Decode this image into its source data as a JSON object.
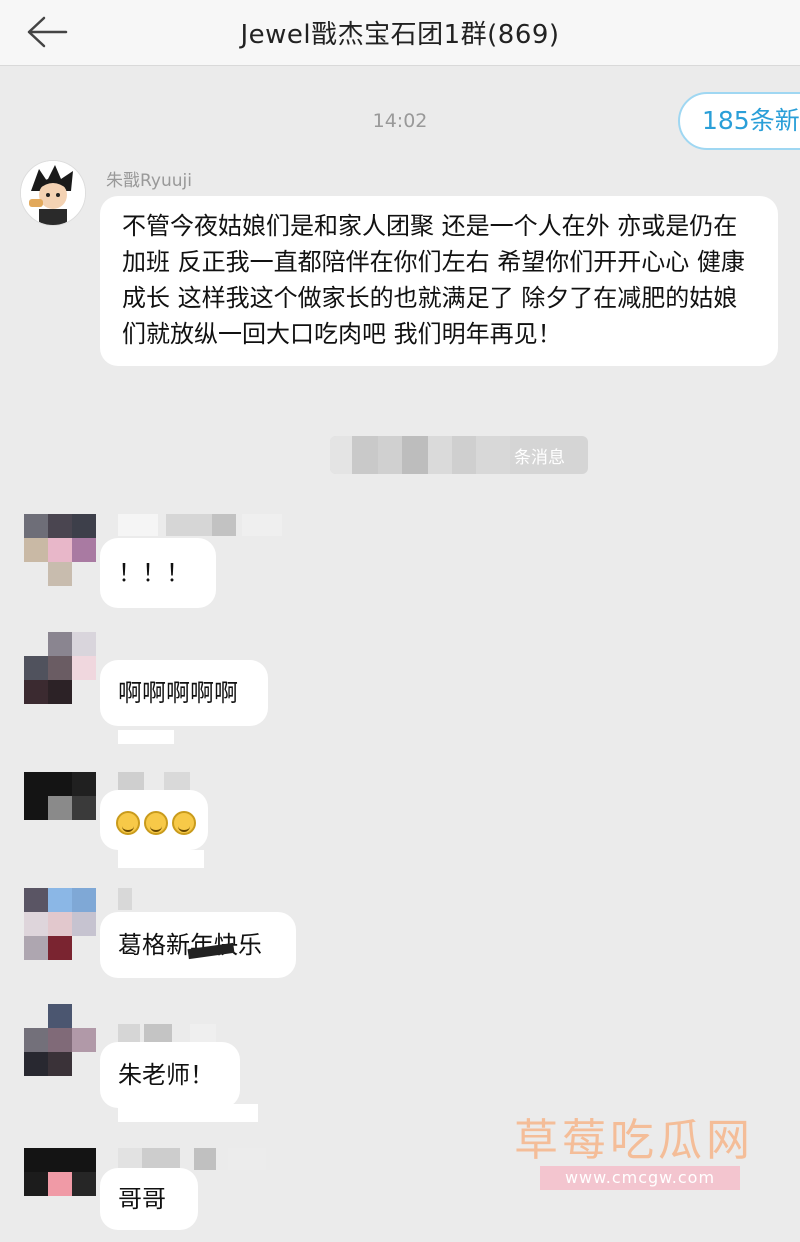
{
  "header": {
    "title": "Jewel戬杰宝石团1群(869)"
  },
  "new_messages_pill": "185条新",
  "timestamp": "14:02",
  "pinned_message": {
    "sender": "朱戬Ryuuji",
    "text": "不管今夜姑娘们是和家人团聚 还是一个人在外 亦或是仍在加班 反正我一直都陪伴在你们左右 希望你们开开心心 健康成长 这样我这个做家长的也就满足了 除夕了在减肥的姑娘们就放纵一回大口吃肉吧 我们明年再见！"
  },
  "system_notice": "条消息",
  "messages": [
    {
      "text": "！！！"
    },
    {
      "text": "啊啊啊啊啊"
    },
    {
      "emoji": [
        "laugh-cry-icon",
        "laugh-cry-icon",
        "laugh-cry-icon"
      ]
    },
    {
      "text": "葛格新年快乐"
    },
    {
      "text": "朱老师！"
    },
    {
      "text": "哥哥"
    }
  ],
  "watermark": {
    "title": "草莓吃瓜网",
    "url": "www.cmcgw.com"
  },
  "colors": {
    "background": "#ebebeb",
    "bubble": "#ffffff",
    "pill_border": "#9fd7f2",
    "pill_text": "#2a9fd8",
    "watermark": "#f6b990"
  }
}
